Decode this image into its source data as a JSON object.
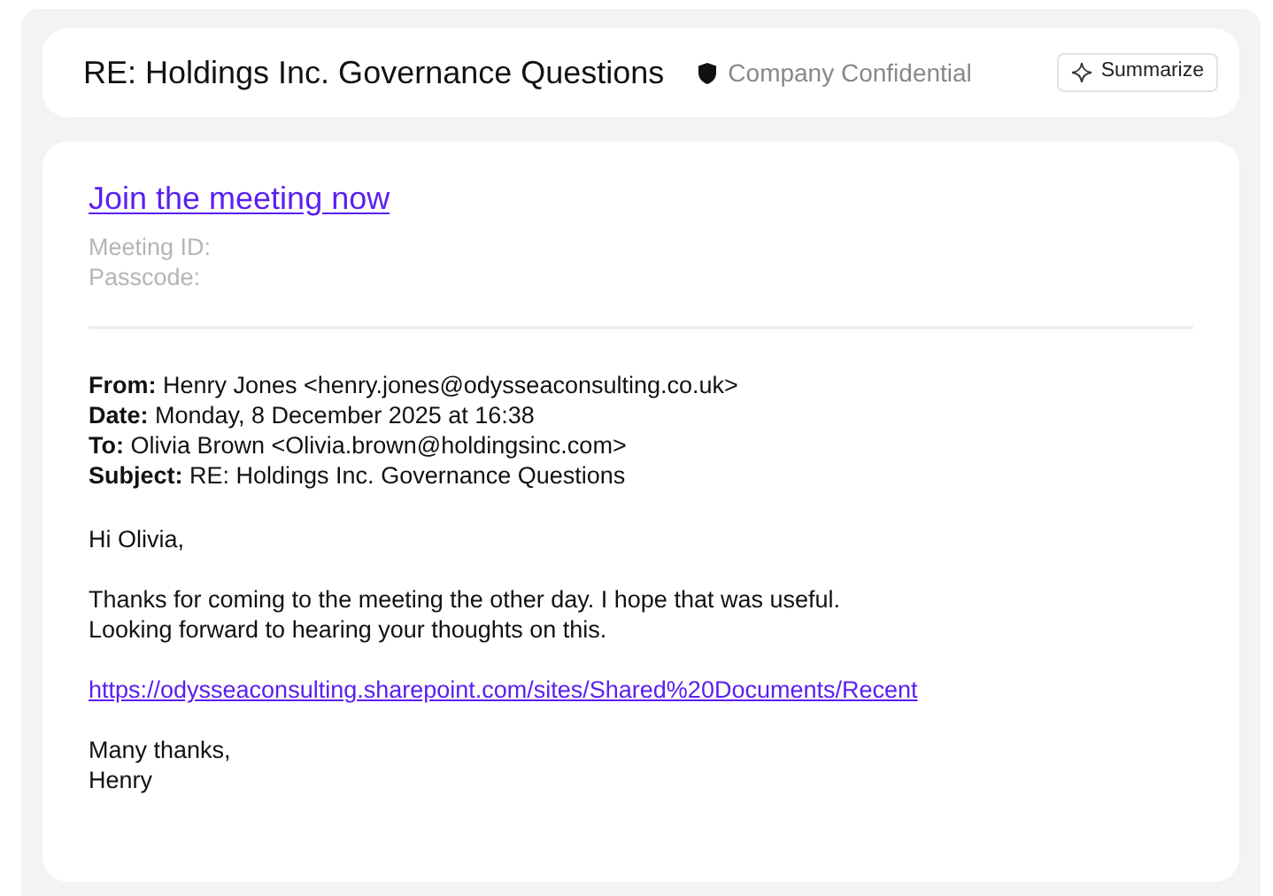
{
  "subject": "RE: Holdings Inc. Governance Questions",
  "classification": {
    "label": "Company Confidential"
  },
  "summarize_button": {
    "label": "Summarize"
  },
  "meeting": {
    "join_link": "Join the meeting now",
    "details": [
      "Meeting ID:",
      "Passcode:"
    ]
  },
  "headers": [
    {
      "label": "From:",
      "value": "Henry Jones <henry.jones@odysseaconsulting.co.uk>"
    },
    {
      "label": "Date:",
      "value": "Monday, 8 December 2025 at 16:38"
    },
    {
      "label": "To:",
      "value": "Olivia Brown <Olivia.brown@holdingsinc.com>"
    },
    {
      "label": "Subject:",
      "value": "RE: Holdings Inc. Governance Questions"
    }
  ],
  "body": [
    {
      "kind": "text",
      "lines": [
        "Hi Olivia,"
      ]
    },
    {
      "kind": "text",
      "lines": [
        "Thanks for coming to the meeting the other day. I hope that was useful.",
        "Looking forward to hearing your thoughts on this."
      ]
    },
    {
      "kind": "link",
      "lines": [
        "https://odysseaconsulting.sharepoint.com/sites/Shared%20Documents/Recent"
      ]
    },
    {
      "kind": "text",
      "lines": [
        "Many thanks,",
        "Henry"
      ]
    }
  ]
}
